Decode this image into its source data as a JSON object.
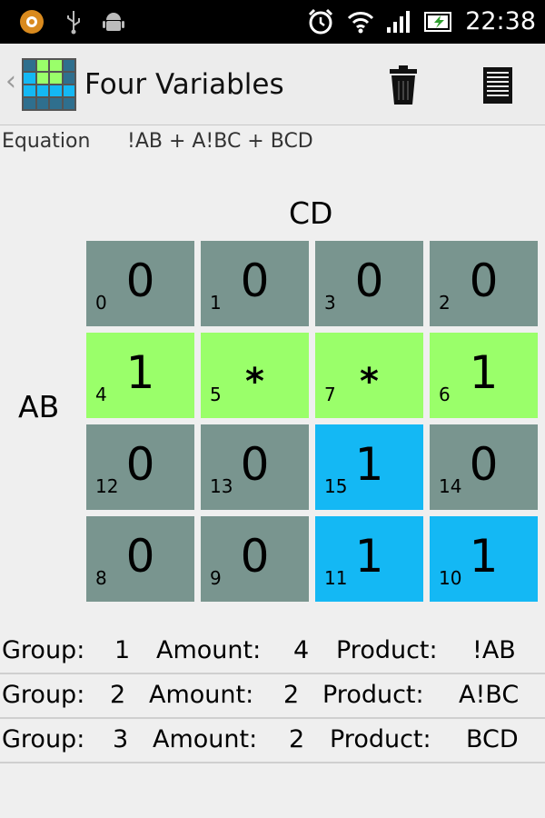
{
  "status_bar": {
    "time": "22:38",
    "icons": [
      "notification-app-icon",
      "usb-icon",
      "android-debug-icon",
      "alarm-icon",
      "wifi-icon",
      "signal-icon",
      "battery-icon"
    ]
  },
  "action_bar": {
    "title": "Four Variables",
    "up_caret": "‹",
    "actions": [
      "trash-icon",
      "menu-icon"
    ]
  },
  "equation": {
    "label": "Equation",
    "value": "!AB + A!BC + BCD"
  },
  "kmap": {
    "column_variable": "CD",
    "row_variable": "AB",
    "rows": [
      [
        {
          "index": "0",
          "value": "0",
          "group": 0
        },
        {
          "index": "1",
          "value": "0",
          "group": 0
        },
        {
          "index": "3",
          "value": "0",
          "group": 0
        },
        {
          "index": "2",
          "value": "0",
          "group": 0
        }
      ],
      [
        {
          "index": "4",
          "value": "1",
          "group": 1
        },
        {
          "index": "5",
          "value": "*",
          "group": 1
        },
        {
          "index": "7",
          "value": "*",
          "group": 1
        },
        {
          "index": "6",
          "value": "1",
          "group": 1
        }
      ],
      [
        {
          "index": "12",
          "value": "0",
          "group": 0
        },
        {
          "index": "13",
          "value": "0",
          "group": 0
        },
        {
          "index": "15",
          "value": "1",
          "group": 2
        },
        {
          "index": "14",
          "value": "0",
          "group": 0
        }
      ],
      [
        {
          "index": "8",
          "value": "0",
          "group": 0
        },
        {
          "index": "9",
          "value": "0",
          "group": 0
        },
        {
          "index": "11",
          "value": "1",
          "group": 2
        },
        {
          "index": "10",
          "value": "1",
          "group": 2
        }
      ]
    ],
    "colors": {
      "zero": "#79958f",
      "group_1": "#9aff6a",
      "group_2": "#14b8f4"
    }
  },
  "groups": [
    {
      "group_label": "Group:",
      "group": "1",
      "amount_label": "Amount:",
      "amount": "4",
      "product_label": "Product:",
      "product": "!AB"
    },
    {
      "group_label": "Group:",
      "group": "2",
      "amount_label": "Amount:",
      "amount": "2",
      "product_label": "Product:",
      "product": "A!BC"
    },
    {
      "group_label": "Group:",
      "group": "3",
      "amount_label": "Amount:",
      "amount": "2",
      "product_label": "Product:",
      "product": "BCD"
    }
  ]
}
